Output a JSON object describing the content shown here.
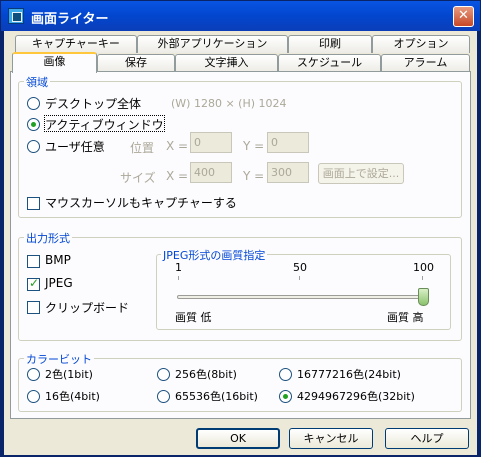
{
  "window": {
    "title": "画面ライター",
    "close_glyph": "✕"
  },
  "tabs": {
    "row_back": [
      "キャプチャーキー",
      "外部アプリケーション",
      "印刷",
      "オプション"
    ],
    "row_front": [
      "画像",
      "保存",
      "文字挿入",
      "スケジュール",
      "アラーム"
    ],
    "active": "画像"
  },
  "region": {
    "title": "領域",
    "desktop_label": "デスクトップ全体",
    "desktop_size": "(W) 1280 × (H) 1024",
    "active_window_label": "アクティブウィンドウ",
    "custom_label": "ユーザ任意",
    "position_label": "位置",
    "size_label": "サイズ",
    "x_label": "X =",
    "y_label": "Y =",
    "pos_x": "0",
    "pos_y": "0",
    "size_x": "400",
    "size_y": "300",
    "set_on_screen_button": "画面上で設定...",
    "mouse_cursor_label": "マウスカーソルもキャプチャーする",
    "selected": "active_window",
    "mouse_cursor_checked": false
  },
  "output": {
    "title": "出力形式",
    "bmp_label": "BMP",
    "jpeg_label": "JPEG",
    "clipboard_label": "クリップボード",
    "bmp_checked": false,
    "jpeg_checked": true,
    "clipboard_checked": false,
    "jpeg_quality": {
      "title": "JPEG形式の画質指定",
      "min_label": "1",
      "mid_label": "50",
      "max_label": "100",
      "low_label": "画質 低",
      "high_label": "画質 高",
      "value": 100
    }
  },
  "color_bit": {
    "title": "カラービット",
    "options": [
      "2色(1bit)",
      "256色(8bit)",
      "16777216色(24bit)",
      "16色(4bit)",
      "65536色(16bit)",
      "4294967296色(32bit)"
    ],
    "selected": "4294967296色(32bit)"
  },
  "footer": {
    "ok": "OK",
    "cancel": "キャンセル",
    "help": "ヘルプ"
  }
}
